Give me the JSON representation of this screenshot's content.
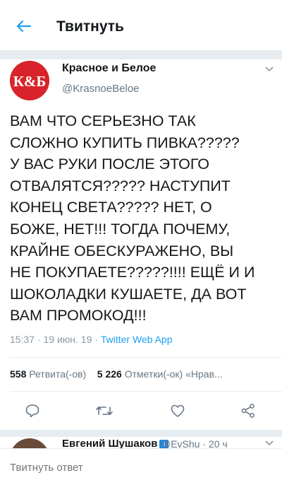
{
  "header": {
    "title": "Твитнуть",
    "back_icon": "arrow-left-icon",
    "accent": "#1da1f2"
  },
  "tweet": {
    "author": {
      "name": "Красное и Белое",
      "handle": "@KrasnoeBeloe",
      "avatar_text": "К&Б",
      "avatar_color": "#d8232a"
    },
    "lines": [
      "ВАМ ЧТО СЕРЬЕЗНО ТАК",
      "СЛОЖНО КУПИТЬ ПИВКА?????",
      "У ВАС РУКИ ПОСЛЕ ЭТОГО",
      "ОТВАЛЯТСЯ????? НАСТУПИТ",
      "КОНЕЦ СВЕТА????? НЕТ, О",
      "БОЖЕ, НЕТ!!! ТОГДА ПОЧЕМУ,",
      "КРАЙНЕ ОБЕСКУРАЖЕНО, ВЫ",
      "НЕ ПОКУПАЕТЕ?????!!!! ЕЩЁ И И",
      "ШОКОЛАДКИ КУШАЕТЕ, ДА ВОТ",
      "ВАМ ПРОМОКОД!!!"
    ],
    "time": "15:37",
    "date": "19 июн. 19",
    "dot": "·",
    "app": "Twitter Web App"
  },
  "stats": {
    "retweets_count": "558",
    "retweets_label": "Ретвита(-ов)",
    "likes_count": "5 226",
    "likes_label": "Отметки(-ок) «Нрав..."
  },
  "actions": [
    "reply-icon",
    "retweet-icon",
    "like-icon",
    "share-icon"
  ],
  "reply_preview": {
    "name": "Евгений Шушаков",
    "badge": "i",
    "handle": "@EvShu · 20 ч"
  },
  "reply_bar": {
    "placeholder": "Твитнуть ответ"
  }
}
